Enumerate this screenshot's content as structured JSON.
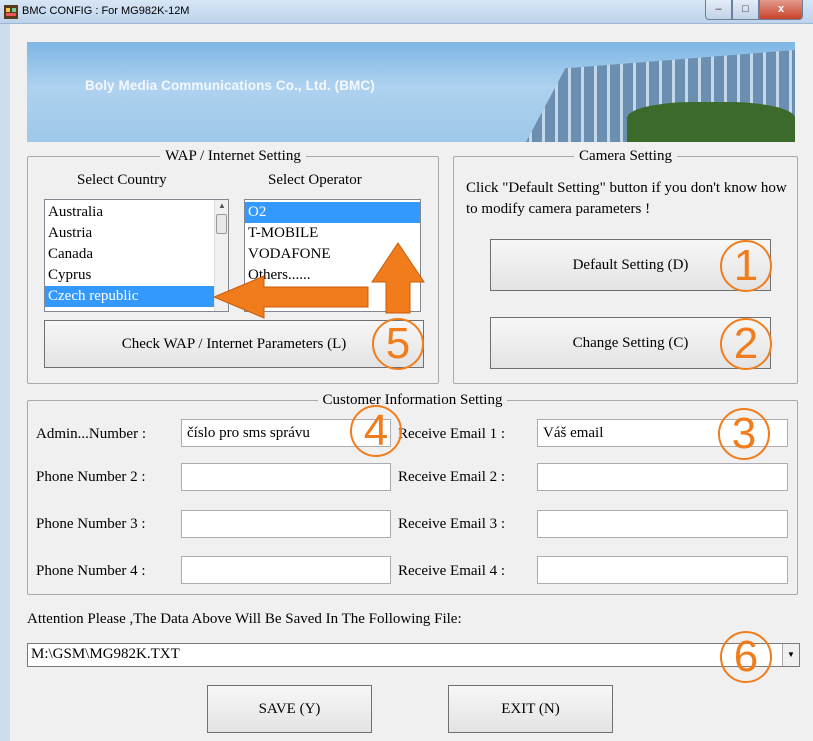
{
  "window": {
    "title": "BMC CONFIG : For MG982K-12M",
    "min_glyph": "–",
    "max_glyph": "□",
    "close_glyph": "x"
  },
  "banner": {
    "text": "Boly Media Communications Co., Ltd. (BMC)"
  },
  "wap": {
    "legend": "WAP / Internet Setting",
    "country_label": "Select Country",
    "operator_label": "Select Operator",
    "countries": [
      "Australia",
      "Austria",
      "Canada",
      "Cyprus",
      "Czech republic"
    ],
    "selected_country": "Czech republic",
    "operators": [
      "O2",
      "T-MOBILE",
      "VODAFONE",
      "Others......"
    ],
    "selected_operator": "O2",
    "check_button": "Check WAP / Internet Parameters (L)"
  },
  "camera": {
    "legend": "Camera Setting",
    "hint": "Click \"Default Setting\" button if you don't know how to modify camera parameters !",
    "default_button": "Default Setting (D)",
    "change_button": "Change Setting (C)"
  },
  "customer": {
    "legend": "Customer Information Setting",
    "phones": [
      {
        "label": "Admin...Number :",
        "value": "číslo pro sms správu"
      },
      {
        "label": "Phone Number 2 :",
        "value": ""
      },
      {
        "label": "Phone Number 3 :",
        "value": ""
      },
      {
        "label": "Phone Number 4 :",
        "value": ""
      }
    ],
    "emails": [
      {
        "label": "Receive Email 1 :",
        "value": "Váš email"
      },
      {
        "label": "Receive Email 2 :",
        "value": ""
      },
      {
        "label": "Receive Email 3 :",
        "value": ""
      },
      {
        "label": "Receive Email 4 :",
        "value": ""
      }
    ]
  },
  "file": {
    "attention": "Attention Please ,The Data Above Will Be Saved In The Following  File:",
    "path": "M:\\GSM\\MG982K.TXT"
  },
  "actions": {
    "save": "SAVE (Y)",
    "exit": "EXIT (N)"
  },
  "annotations": {
    "badges": [
      "1",
      "2",
      "3",
      "4",
      "5",
      "6"
    ],
    "color": "#f07c1c"
  },
  "icons": {
    "app": "bmc-app-icon",
    "scroll_up": "▲",
    "dropdown": "▼"
  }
}
